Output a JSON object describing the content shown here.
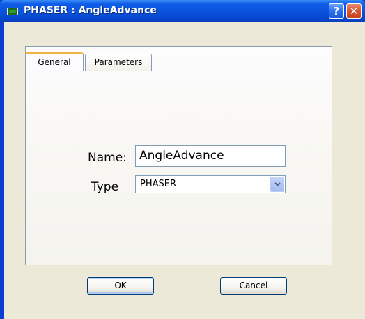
{
  "window": {
    "title": "PHASER : AngleAdvance",
    "help_button": "?",
    "close_button": "✕"
  },
  "tabs": [
    {
      "label": "General",
      "active": true
    },
    {
      "label": "Parameters",
      "active": false
    }
  ],
  "form": {
    "name_label": "Name:",
    "name_value": "AngleAdvance",
    "type_label": "Type",
    "type_value": "PHASER"
  },
  "buttons": {
    "ok": "OK",
    "cancel": "Cancel"
  },
  "colors": {
    "title_bar": "#0a52dc",
    "client_bg": "#ece9d8",
    "active_tab_accent": "#f0b442"
  }
}
